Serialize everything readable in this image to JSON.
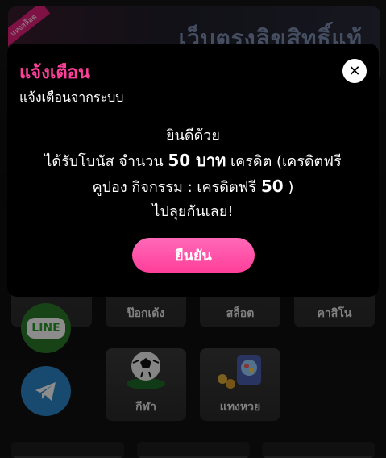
{
  "background": {
    "banner_text": "เว็บตรงลิขสิทธิ์แท้",
    "ribbon_text": "แทงสล็อต",
    "games": [
      {
        "label": "ป๊อกเด้ง"
      },
      {
        "label": "สล็อต"
      },
      {
        "label": "คาสิโน"
      },
      {
        "label": "กีฬา"
      },
      {
        "label": "แทงหวย"
      }
    ],
    "line_label": "LINE"
  },
  "modal": {
    "title": "แจ้งเตือน",
    "subtitle": "แจ้งเตือนจากระบบ",
    "line1": "ยินดีด้วย",
    "line2_prefix": "ได้รับโบนัส จำนวน ",
    "amount": "50 บาท",
    "line2_suffix": " เครดิต (เครดิตฟรี",
    "line3_prefix": "คูปอง กิจกรรม : เครดิตฟรี ",
    "line3_amount": "50",
    "line3_suffix": " )",
    "line4": "ไปลุยกันเลย!",
    "confirm_label": "ยืนยัน",
    "close_symbol": "✕"
  },
  "colors": {
    "accent": "#ff3f9a",
    "button": "#ff69b8"
  }
}
